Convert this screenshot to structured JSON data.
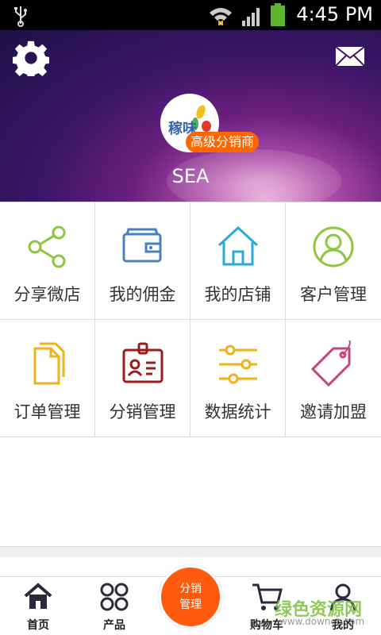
{
  "status_bar": {
    "time": "4:45 PM"
  },
  "profile": {
    "badge": "高级分销商",
    "username": "SEA",
    "logo_text": "稼味"
  },
  "menu": [
    {
      "label": "分享微店",
      "icon": "share-icon",
      "color": "#8dc63f"
    },
    {
      "label": "我的佣金",
      "icon": "wallet-icon",
      "color": "#4a7fc1"
    },
    {
      "label": "我的店铺",
      "icon": "home-icon",
      "color": "#29a9d8"
    },
    {
      "label": "客户管理",
      "icon": "user-circle-icon",
      "color": "#8dc63f"
    },
    {
      "label": "订单管理",
      "icon": "documents-icon",
      "color": "#f0b21b"
    },
    {
      "label": "分销管理",
      "icon": "id-badge-icon",
      "color": "#9b1b1b"
    },
    {
      "label": "数据统计",
      "icon": "sliders-icon",
      "color": "#f0b21b"
    },
    {
      "label": "邀请加盟",
      "icon": "tag-icon",
      "color": "#c4457c"
    }
  ],
  "tabs": {
    "home": "首页",
    "products": "产品",
    "center_line1": "分销",
    "center_line2": "管理",
    "cart": "购物车",
    "mine": "我的"
  },
  "watermark": {
    "text": "绿色资源网",
    "url": "www.downcc.com"
  },
  "colors": {
    "accent": "#ff5a0e",
    "badge": "#ff6600"
  }
}
